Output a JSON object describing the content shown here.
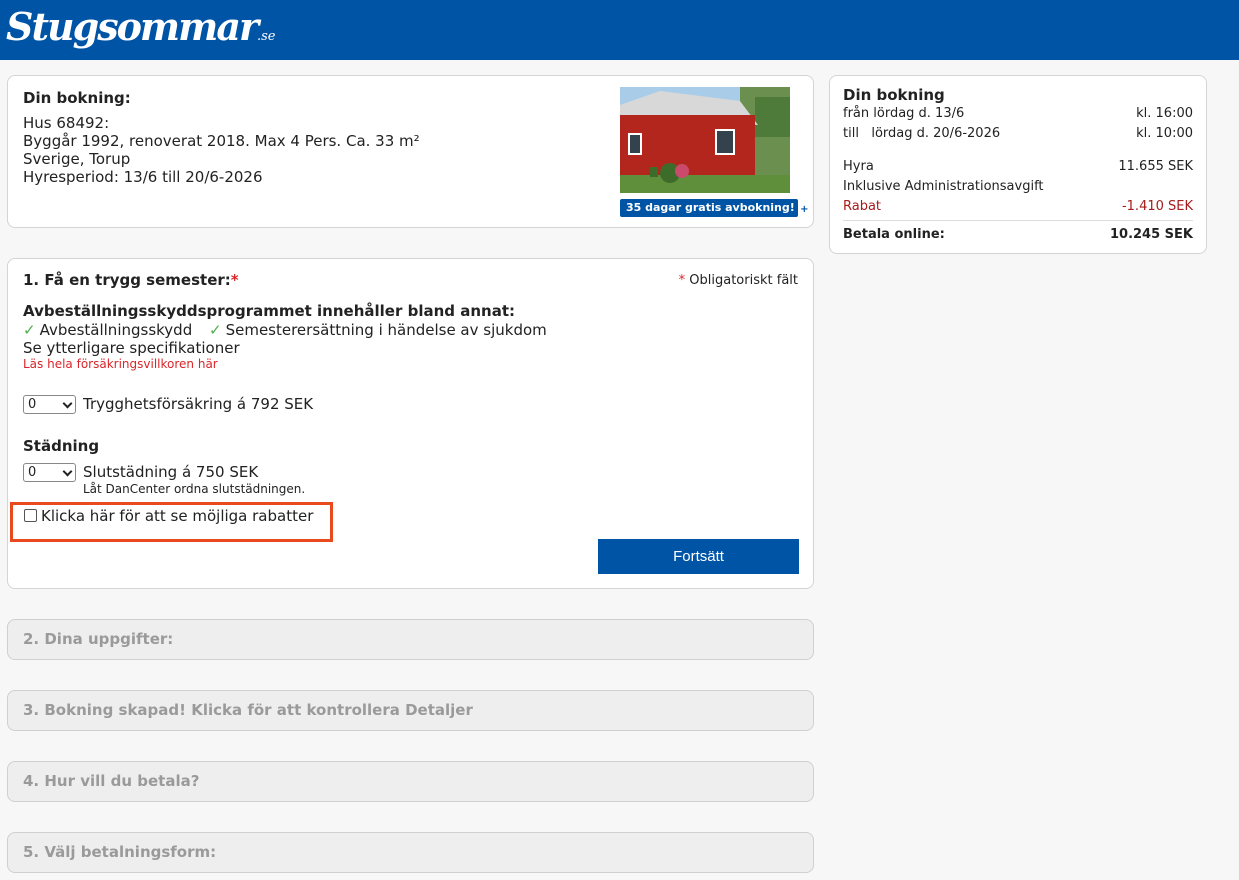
{
  "brand": {
    "logo_main": "Stugsommar",
    "logo_suffix": ".se"
  },
  "booking": {
    "title": "Din bokning:",
    "house": "Hus 68492:",
    "details": "Byggår 1992, renoverat 2018. Max 4 Pers. Ca. 33 m²",
    "location": "Sverige, Torup",
    "period": "Hyresperiod: 13/6 till 20/6-2026",
    "badge": "35 dagar gratis avbokning!",
    "badge_icon": "+"
  },
  "step1": {
    "title": "1. Få en trygg semester:",
    "required_mark": "*",
    "required_note": "Obligatoriskt fält",
    "program_heading": "Avbeställningsskyddsprogrammet innehåller bland annat:",
    "check_mark": "✓",
    "features": [
      "Avbeställningsskydd",
      "Semesterersättning i händelse av sjukdom"
    ],
    "more_specs": "Se ytterligare specifikationer",
    "terms_link": "Läs hela försäkringsvillkoren här",
    "insurance_qty": "0",
    "insurance_label": "Trygghetsförsäkring á 792 SEK",
    "cleaning_heading": "Städning",
    "cleaning_qty": "0",
    "cleaning_label": "Slutstädning á 750 SEK",
    "cleaning_note": "Låt DanCenter ordna slutstädningen.",
    "discount_label": "Klicka här för att se möjliga rabatter",
    "continue_button": "Fortsätt"
  },
  "steps": [
    {
      "label": "2. Dina uppgifter:"
    },
    {
      "label": "3. Bokning skapad! Klicka för att kontrollera Detaljer"
    },
    {
      "label": "4. Hur vill du betala?"
    },
    {
      "label": "5. Välj betalningsform:"
    }
  ],
  "summary": {
    "title": "Din bokning",
    "from_label": "från lördag d. 13/6",
    "from_time": "kl. 16:00",
    "to_label": "till",
    "to_date": "lördag d. 20/6-2026",
    "to_time": "kl. 10:00",
    "rent_label": "Hyra",
    "rent_value": "11.655 SEK",
    "admin_note": "Inklusive Administrationsavgift",
    "discount_label": "Rabat",
    "discount_value": "-1.410 SEK",
    "total_label": "Betala online:",
    "total_value": "10.245 SEK"
  },
  "colors": {
    "brand_blue": "#0054a6",
    "required_red": "#d9262a",
    "highlight_orange": "#e8491d",
    "check_green": "#4caf50"
  }
}
